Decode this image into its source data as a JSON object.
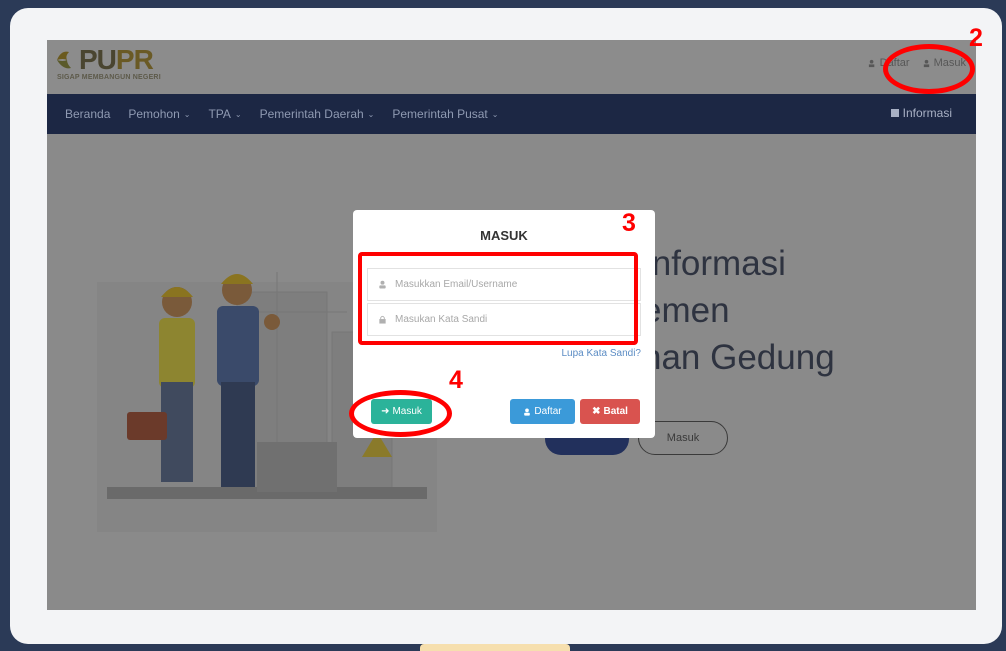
{
  "logo": {
    "word_a": "PU",
    "word_b": "PR",
    "tagline": "SIGAP MEMBANGUN NEGERI"
  },
  "top_links": {
    "daftar": "Daftar",
    "masuk": "Masuk"
  },
  "nav": {
    "items": [
      {
        "label": "Beranda",
        "dropdown": false
      },
      {
        "label": "Pemohon",
        "dropdown": true
      },
      {
        "label": "TPA",
        "dropdown": true
      },
      {
        "label": "Pemerintah Daerah",
        "dropdown": true
      },
      {
        "label": "Pemerintah Pusat",
        "dropdown": true
      }
    ],
    "info": "Informasi"
  },
  "hero": {
    "title_lines": [
      "Informasi",
      "emen",
      "nan Gedung"
    ],
    "button_secondary": "Masuk"
  },
  "modal": {
    "title": "MASUK",
    "email_placeholder": "Masukkan Email/Username",
    "password_placeholder": "Masukan Kata Sandi",
    "forgot": "Lupa Kata Sandi?",
    "btn_login": "Masuk",
    "btn_register": "Daftar",
    "btn_cancel": "Batal"
  },
  "annotations": {
    "step2": "2",
    "step3": "3",
    "step4": "4"
  },
  "colors": {
    "annotation": "#ff0000",
    "navbar": "#1c2744",
    "btn_login": "#2bb39a",
    "btn_register": "#3b9ad9",
    "btn_cancel": "#d9534f"
  }
}
